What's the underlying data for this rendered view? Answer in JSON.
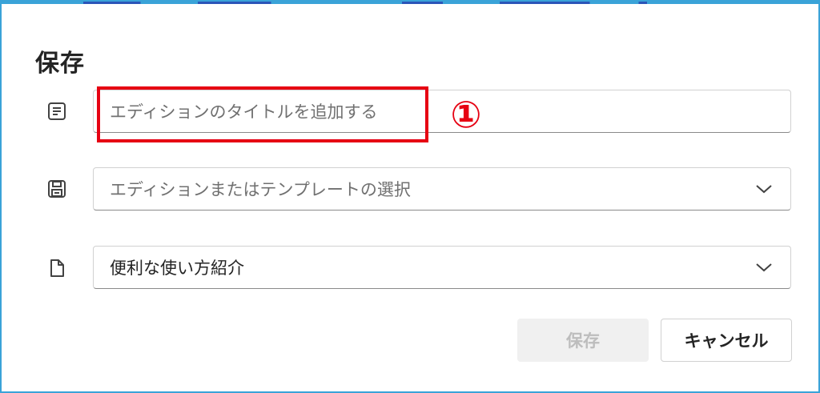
{
  "dialog": {
    "title": "保存"
  },
  "fields": {
    "title_input": {
      "placeholder": "エディションのタイトルを追加する",
      "icon": "text-document-icon"
    },
    "edition_select": {
      "placeholder": "エディションまたはテンプレートの選択",
      "icon": "save-disk-icon"
    },
    "article_select": {
      "value": "便利な使い方紹介",
      "icon": "page-icon"
    }
  },
  "annotation": {
    "step_marker": "①",
    "highlight_color": "#e60012"
  },
  "buttons": {
    "save_label": "保存",
    "cancel_label": "キャンセル"
  },
  "colors": {
    "frame_border": "#3aa3d8",
    "save_disabled_bg": "#f0f0f0",
    "save_disabled_text": "#bdbdbd"
  }
}
